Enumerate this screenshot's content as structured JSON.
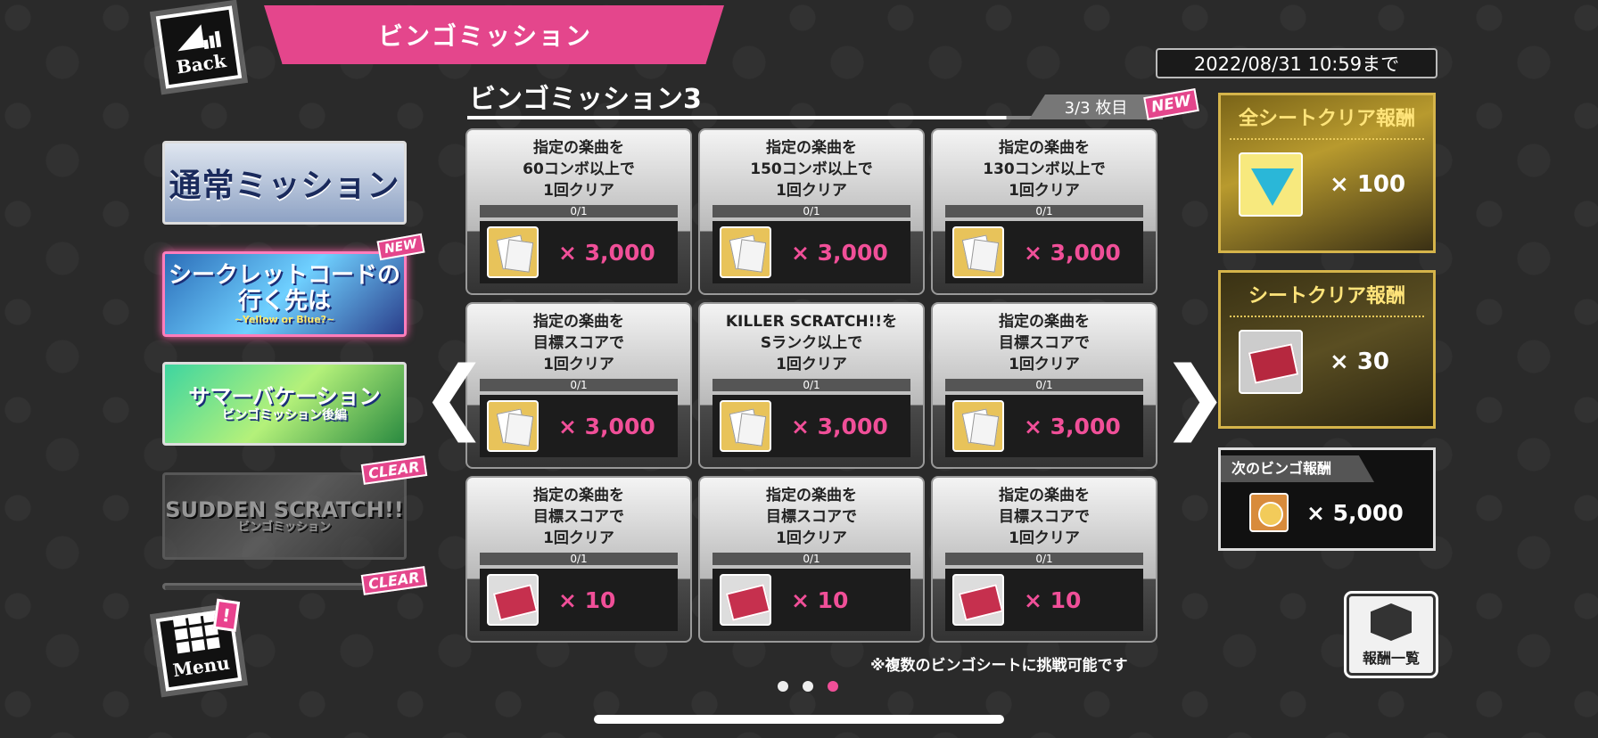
{
  "header": {
    "back_label": "Back",
    "menu_label": "Menu",
    "title": "ビンゴミッション",
    "deadline": "2022/08/31 10:59まで"
  },
  "sheet": {
    "title": "ビンゴミッション3",
    "count": "3/3 枚目",
    "new_tag": "NEW"
  },
  "side": {
    "normal_label": "通常ミッション",
    "secret_label": "シークレットコードの行く先は",
    "secret_sub": "~Yellow or Blue?~",
    "secret_tag": "NEW",
    "summer_label": "サマーバケーション",
    "summer_sub": "ビンゴミッション後編",
    "sudden_label": "SUDDEN SCRATCH!!",
    "sudden_sub": "ビンゴミッション",
    "sudden_tag": "CLEAR",
    "partial_tag": "CLEAR"
  },
  "cells": [
    {
      "cond": "指定の楽曲を\n60コンボ以上で\n1回クリア",
      "progress": "0/1",
      "icon": "document-icon",
      "qty": "× 3,000"
    },
    {
      "cond": "指定の楽曲を\n150コンボ以上で\n1回クリア",
      "progress": "0/1",
      "icon": "document-icon",
      "qty": "× 3,000"
    },
    {
      "cond": "指定の楽曲を\n130コンボ以上で\n1回クリア",
      "progress": "0/1",
      "icon": "document-icon",
      "qty": "× 3,000"
    },
    {
      "cond": "指定の楽曲を\n目標スコアで\n1回クリア",
      "progress": "0/1",
      "icon": "document-icon",
      "qty": "× 3,000"
    },
    {
      "cond": "KILLER SCRATCH!!を\nSランク以上で\n1回クリア",
      "progress": "0/1",
      "icon": "document-icon",
      "qty": "× 3,000"
    },
    {
      "cond": "指定の楽曲を\n目標スコアで\n1回クリア",
      "progress": "0/1",
      "icon": "document-icon",
      "qty": "× 3,000"
    },
    {
      "cond": "指定の楽曲を\n目標スコアで\n1回クリア",
      "progress": "0/1",
      "icon": "ticket-icon",
      "qty": "× 10"
    },
    {
      "cond": "指定の楽曲を\n目標スコアで\n1回クリア",
      "progress": "0/1",
      "icon": "ticket-icon",
      "qty": "× 10"
    },
    {
      "cond": "指定の楽曲を\n目標スコアで\n1回クリア",
      "progress": "0/1",
      "icon": "ticket-icon",
      "qty": "× 10"
    }
  ],
  "rewards": {
    "all_clear_title": "全シートクリア報酬",
    "all_clear_qty": "× 100",
    "sheet_clear_title": "シートクリア報酬",
    "sheet_clear_qty": "× 30",
    "next_bingo_title": "次のビンゴ報酬",
    "next_bingo_qty": "× 5,000"
  },
  "reward_list_label": "報酬一覧",
  "note": "※複数のビンゴシートに挑戦可能です",
  "pagination": {
    "count": 3,
    "active": 3
  },
  "colors": {
    "accent": "#e4468c",
    "gold": "#d5b44a"
  }
}
